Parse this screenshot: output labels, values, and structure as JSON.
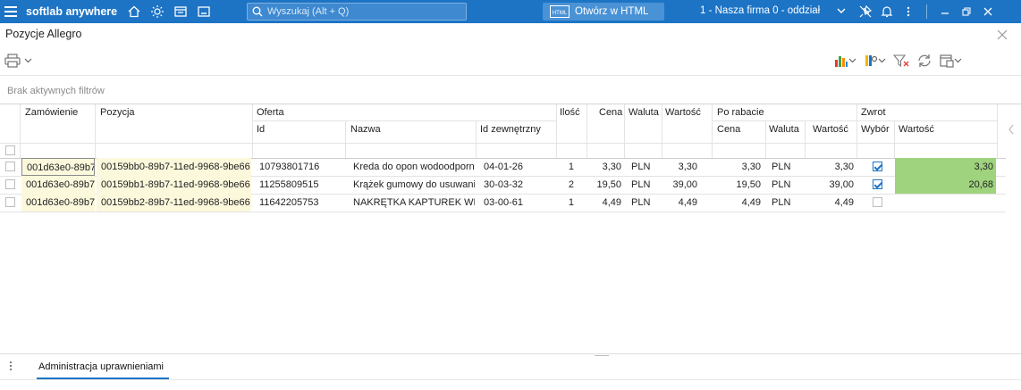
{
  "topbar": {
    "brand": "softlab anywhere",
    "search_placeholder": "Wyszukaj (Alt + Q)",
    "html_button": "Otwórz w HTML",
    "html_icon_text": "HTML",
    "company": "1 - Nasza firma 0 - oddział",
    "bg_color": "#1d74c5"
  },
  "window": {
    "title": "Pozycje Allegro",
    "filter_status": "Brak aktywnych filtrów"
  },
  "columns": {
    "zamowienie": "Zamówienie",
    "pozycja": "Pozycja",
    "oferta": "Oferta",
    "oferta_id": "Id",
    "oferta_nazwa": "Nazwa",
    "oferta_idzew": "Id zewnętrzny",
    "ilosc": "Ilość",
    "cena": "Cena",
    "waluta": "Waluta",
    "wartosc": "Wartość",
    "po_rabacie": "Po rabacie",
    "pr_cena": "Cena",
    "pr_waluta": "Waluta",
    "pr_wartosc": "Wartość",
    "zwrot": "Zwrot",
    "zwrot_wybor": "Wybór",
    "zwrot_wartosc": "Wartość"
  },
  "rows": [
    {
      "zamowienie": "001d63e0-89b7",
      "pozycja": "00159bb0-89b7-11ed-9968-9be66",
      "oferta_id": "10793801716",
      "nazwa": "Kreda do opon wodoodporna",
      "id_zew": "04-01-26",
      "ilosc": "1",
      "cena": "3,30",
      "waluta": "PLN",
      "wartosc": "3,30",
      "pr_cena": "3,30",
      "pr_waluta": "PLN",
      "pr_wartosc": "3,30",
      "zwrot_wybor": true,
      "zwrot_wartosc": "3,30"
    },
    {
      "zamowienie": "001d63e0-89b7",
      "pozycja": "00159bb1-89b7-11ed-9968-9be66",
      "oferta_id": "11255809515",
      "nazwa": "Krążek gumowy do usuwania",
      "id_zew": "30-03-32",
      "ilosc": "2",
      "cena": "19,50",
      "waluta": "PLN",
      "wartosc": "39,00",
      "pr_cena": "19,50",
      "pr_waluta": "PLN",
      "pr_wartosc": "39,00",
      "zwrot_wybor": true,
      "zwrot_wartosc": "20,68"
    },
    {
      "zamowienie": "001d63e0-89b7",
      "pozycja": "00159bb2-89b7-11ed-9968-9be66",
      "oferta_id": "11642205753",
      "nazwa": "NAKRĘTKA KAPTUREK WENTYLA",
      "id_zew": "03-00-61",
      "ilosc": "1",
      "cena": "4,49",
      "waluta": "PLN",
      "wartosc": "4,49",
      "pr_cena": "4,49",
      "pr_waluta": "PLN",
      "pr_wartosc": "4,49",
      "zwrot_wybor": false,
      "zwrot_wartosc": ""
    }
  ],
  "bottom": {
    "tab": "Administracja uprawnieniami"
  },
  "icons": {
    "menu": "hamburger-icon",
    "home": "home-icon",
    "theme": "sun-icon",
    "search": "search-icon",
    "html": "html-icon",
    "notifications": "bell-icon",
    "print": "printer-icon",
    "chart": "bar-chart-icon",
    "refresh": "refresh-icon"
  }
}
